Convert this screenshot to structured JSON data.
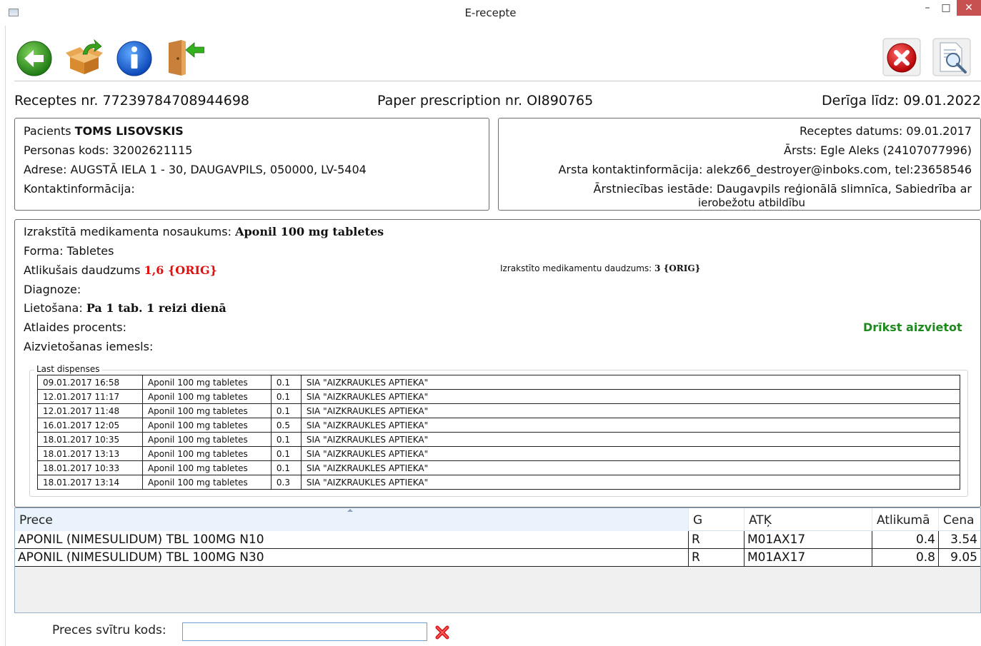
{
  "window": {
    "title": "E-recepte",
    "minimize": "–",
    "maximize": "□",
    "close": "✕"
  },
  "toolbar": {
    "icons": [
      "back-arrow-icon",
      "open-box-icon",
      "info-icon",
      "exit-door-icon",
      "cancel-icon",
      "preview-magnifier-icon"
    ],
    "info_glyph": "i"
  },
  "header": {
    "recipe_no": "Receptes nr. 77239784708944698",
    "paper_no": "Paper prescription nr. OI890765",
    "valid_until": "Derīga līdz: 09.01.2022"
  },
  "patient": {
    "name_label": "Pacients ",
    "name": "TOMS LISOVSKIS",
    "personal_code": "Personas kods: 32002621115",
    "address": "Adrese: AUGSTĀ IELA 1 - 30, DAUGAVPILS, 050000, LV-5404",
    "contact": "Kontaktinformācija:"
  },
  "doctor": {
    "date": "Receptes datums: 09.01.2017",
    "doctor": "Ārsts: Egle Aleks (24107077996)",
    "contact": "Arsta kontaktinformācija: alekz66_destroyer@inboks.com, tel:23658546",
    "institution_1": "Ārstniecības iestāde: Daugavpils reģionālā slimnīca, Sabiedrība ar",
    "institution_2": "ierobežotu atbildību"
  },
  "medication": {
    "name_label": "Izrakstītā medikamenta nosaukums: ",
    "name": "Aponil 100 mg tabletes",
    "form": "Forma: Tabletes",
    "remaining_label": "Atlikušais daudzums ",
    "remaining_value": "1,6 {ORIG}",
    "prescribed_label": "Izrakstīto medikamentu daudzums: ",
    "prescribed_value": "3 {ORIG}",
    "diagnosis": "Diagnoze:",
    "usage_label": "Lietošana: ",
    "usage_value": "Pa 1 tab. 1 reizi dienā",
    "discount": "Atlaides procents:",
    "substitution_allowed": "Drīkst aizvietot",
    "substitution_reason": "Aizvietošanas iemesls:"
  },
  "dispenses": {
    "legend": "Last dispenses",
    "rows": [
      [
        "09.01.2017 16:58",
        "Aponil 100 mg tabletes",
        "0.1",
        "SIA \"AIZKRAUKLES APTIEKA\""
      ],
      [
        "12.01.2017 11:17",
        "Aponil 100 mg tabletes",
        "0.1",
        "SIA \"AIZKRAUKLES APTIEKA\""
      ],
      [
        "12.01.2017 11:48",
        "Aponil 100 mg tabletes",
        "0.1",
        "SIA \"AIZKRAUKLES APTIEKA\""
      ],
      [
        "16.01.2017 12:05",
        "Aponil 100 mg tabletes",
        "0.5",
        "SIA \"AIZKRAUKLES APTIEKA\""
      ],
      [
        "18.01.2017 10:35",
        "Aponil 100 mg tabletes",
        "0.1",
        "SIA \"AIZKRAUKLES APTIEKA\""
      ],
      [
        "18.01.2017 13:13",
        "Aponil 100 mg tabletes",
        "0.1",
        "SIA \"AIZKRAUKLES APTIEKA\""
      ],
      [
        "18.01.2017 10:33",
        "Aponil 100 mg tabletes",
        "0.1",
        "SIA \"AIZKRAUKLES APTIEKA\""
      ],
      [
        "18.01.2017 13:14",
        "Aponil 100 mg tabletes",
        "0.3",
        "SIA \"AIZKRAUKLES APTIEKA\""
      ]
    ]
  },
  "goods": {
    "columns": [
      "Prece",
      "G",
      "ATĶ",
      "Atlikumā",
      "Cena"
    ],
    "rows": [
      [
        "APONIL (NIMESULIDUM) TBL 100MG N10",
        "R",
        "M01AX17",
        "0.4",
        "3.54"
      ],
      [
        "APONIL (NIMESULIDUM) TBL 100MG N30",
        "R",
        "M01AX17",
        "0.8",
        "9.05"
      ]
    ]
  },
  "barcode": {
    "label": "Preces svītru kods:",
    "value": ""
  },
  "colors": {
    "remaining_red": "#e01010",
    "substitution_green": "#1e8a1e",
    "close_button": "#c75050"
  }
}
